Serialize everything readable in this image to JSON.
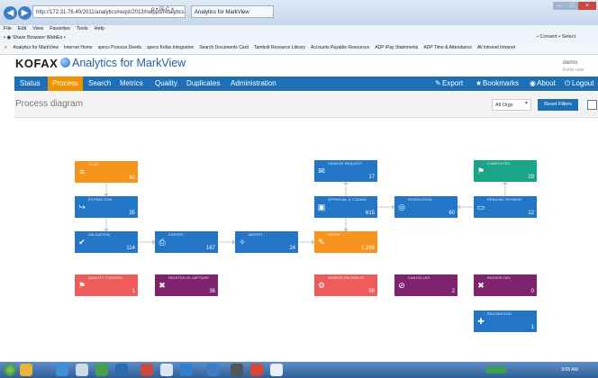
{
  "browser": {
    "address": "http://172.31.76.40/2011/analytics/reqst/2013/helpps/AnalyticsMView",
    "address_controls": "ρ • ☒ C ×",
    "tab_title": "Analytics for MarkView",
    "menu": [
      "File",
      "Edit",
      "View",
      "Favorites",
      "Tools",
      "Help"
    ],
    "command_bar": "• ◉ Share Browser  WebEx •",
    "favorites": [
      "Analytics for MarkView",
      "Internet Home",
      "specs Process Deeds",
      "specs Kofax Integration",
      "Search Documents Card",
      "Tambolt Resource Library",
      "Accounts Payable Resources",
      "ADP iPay Statements",
      "ADP Time & Attendance",
      "All Intranet Intranet"
    ],
    "fav_right": "• Convert •  Select"
  },
  "app": {
    "logo": "KOFAX",
    "title": "Analytics for MarkView",
    "user_name": "demo",
    "user_sub": "Kofax user"
  },
  "nav": {
    "items": [
      "Status",
      "Process",
      "Search",
      "Metrics",
      "Quality",
      "Duplicates",
      "Administration"
    ],
    "right": [
      "Export",
      "Bookmarks",
      "About",
      "Logout"
    ]
  },
  "subheader": {
    "page_title": "Process diagram",
    "orgs": "All Orgs",
    "reset": "Reset Filters"
  },
  "nodes": [
    {
      "id": "scan",
      "label": "SCAN",
      "count": "40",
      "icon": "barcode-icon",
      "glyph": "≡",
      "color": "orange"
    },
    {
      "id": "extraction",
      "label": "EXTRACTION",
      "count": "35",
      "icon": "share-icon",
      "glyph": "↪",
      "color": "blue"
    },
    {
      "id": "validation",
      "label": "VALIDATION",
      "count": "114",
      "icon": "check-icon",
      "glyph": "✔",
      "color": "blue"
    },
    {
      "id": "quality-control",
      "label": "QUALITY CONTROL",
      "count": "1",
      "icon": "flag-icon",
      "glyph": "⚑",
      "color": "red"
    },
    {
      "id": "export",
      "label": "EXPORT",
      "count": "167",
      "icon": "document-icon",
      "glyph": "⎙",
      "color": "blue"
    },
    {
      "id": "deleted-capture",
      "label": "DELETED IN CAPTURE",
      "count": "36",
      "icon": "trash-icon",
      "glyph": "✖",
      "color": "purple"
    },
    {
      "id": "import",
      "label": "IMPORT",
      "count": "24",
      "icon": "move-icon",
      "glyph": "✧",
      "color": "blue"
    },
    {
      "id": "entry",
      "label": "ENTRY",
      "count": "1,286",
      "icon": "edit-icon",
      "glyph": "✎",
      "color": "orange"
    },
    {
      "id": "vendor-request",
      "label": "VENDOR REQUEST",
      "count": "17",
      "icon": "comment-icon",
      "glyph": "✉",
      "color": "blue"
    },
    {
      "id": "approval",
      "label": "APPROVAL & CODING",
      "count": "815",
      "icon": "window-icon",
      "glyph": "▣",
      "color": "blue"
    },
    {
      "id": "workflow-error",
      "label": "WORKFLOW ERROR",
      "count": "56",
      "icon": "gear-icon",
      "glyph": "⚙",
      "color": "red"
    },
    {
      "id": "resolution",
      "label": "RESOLUTION",
      "count": "60",
      "icon": "target-icon",
      "glyph": "◎",
      "color": "blue"
    },
    {
      "id": "cancelled",
      "label": "CANCELLED",
      "count": "2",
      "icon": "ban-icon",
      "glyph": "⊘",
      "color": "purple"
    },
    {
      "id": "completed",
      "label": "COMPLETED",
      "count": "29",
      "icon": "flag-done-icon",
      "glyph": "⚑",
      "color": "green"
    },
    {
      "id": "pending-payment",
      "label": "PENDING PAYMENT",
      "count": "12",
      "icon": "card-icon",
      "glyph": "▭",
      "color": "blue"
    },
    {
      "id": "invoice-del",
      "label": "INVOICE DEL",
      "count": "0",
      "icon": "trash-icon",
      "glyph": "✖",
      "color": "purple"
    },
    {
      "id": "reconciled",
      "label": "RECONCILED",
      "count": "1",
      "icon": "arrows-icon",
      "glyph": "✚",
      "color": "blue"
    }
  ],
  "taskbar": {
    "clock": "9:05 AM"
  }
}
